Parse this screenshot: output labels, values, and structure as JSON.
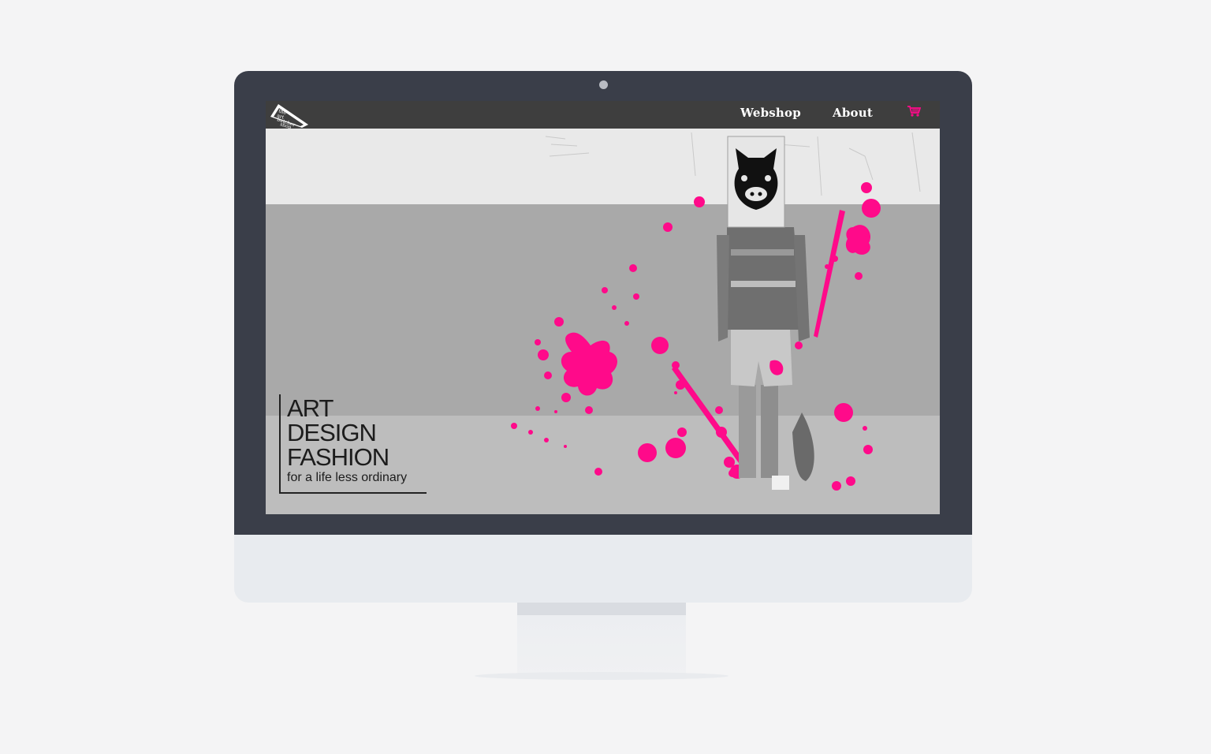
{
  "nav": {
    "logo_name": "logo",
    "links": [
      "Webshop",
      "About"
    ],
    "cart_icon": "cart-icon"
  },
  "hero": {
    "lines": [
      "ART",
      "DESIGN",
      "FASHION"
    ],
    "subtitle": "for a life less ordinary"
  },
  "colors": {
    "accent": "#ff0a8a",
    "navbar": "#3e3e3e",
    "bezel": "#3a3e49"
  }
}
